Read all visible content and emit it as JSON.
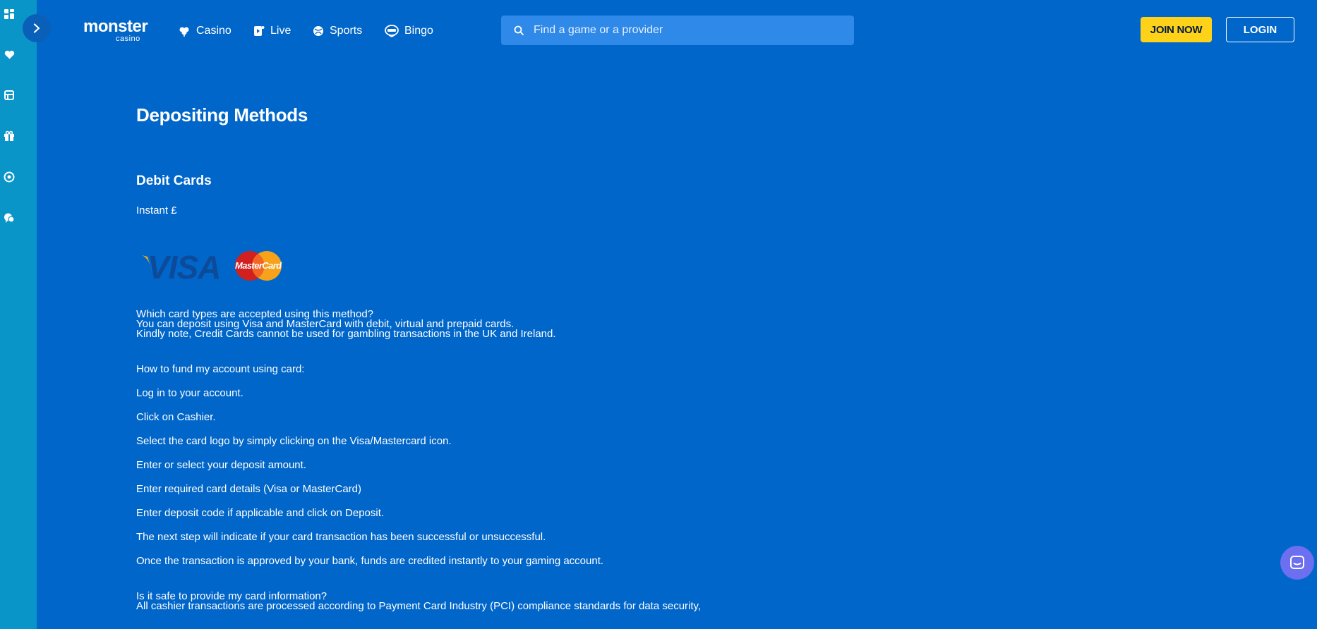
{
  "sidebar": {
    "icons": [
      "dashboard-icon",
      "heart-icon",
      "casino-chips-icon",
      "gift-icon",
      "sports-ball-icon",
      "chat-support-icon"
    ]
  },
  "header": {
    "logo_line1": "mοnster",
    "logo_line2": "casino",
    "nav": [
      {
        "label": "Casino",
        "icon": "clover-icon"
      },
      {
        "label": "Live",
        "icon": "live-icon"
      },
      {
        "label": "Sports",
        "icon": "ball-icon"
      },
      {
        "label": "Bingo",
        "icon": "bingo-icon"
      }
    ],
    "search_placeholder": "Find a game or a provider",
    "join_label": "JOIN NOW",
    "login_label": "LOGIN"
  },
  "content": {
    "title": "Depositing Methods",
    "subtitle": "Debit Cards",
    "instant": "Instant £",
    "visa_text": "VISA",
    "mastercard_text": "MasterCard",
    "q1": "Which card types are accepted using this method?",
    "a1_1": "You can deposit using Visa and MasterCard with debit, virtual and prepaid cards.",
    "a1_2": "Kindly note, Credit Cards cannot be used for gambling transactions in the UK and Ireland.",
    "q2": "How to fund my account using card:",
    "steps": [
      "Log in to your account.",
      "Click on Cashier.",
      "Select the card logo by simply clicking on the Visa/Mastercard icon.",
      "Enter or select your deposit amount.",
      "Enter required card details (Visa or MasterCard)",
      "Enter deposit code if applicable and click on Deposit.",
      "The next step will indicate if your card transaction has been successful or unsuccessful.",
      "Once the transaction is approved by your bank, funds are credited instantly to your gaming account."
    ],
    "q3": "Is it safe to provide my card information?",
    "a3_1": "All cashier transactions are processed according to Payment Card Industry (PCI) compliance standards for data security,"
  },
  "colors": {
    "background": "#0166c9",
    "sidebar": "#0a95c9",
    "join_button": "#ffd21a",
    "search": "#2f89e8",
    "chat": "#6b6ff0"
  }
}
